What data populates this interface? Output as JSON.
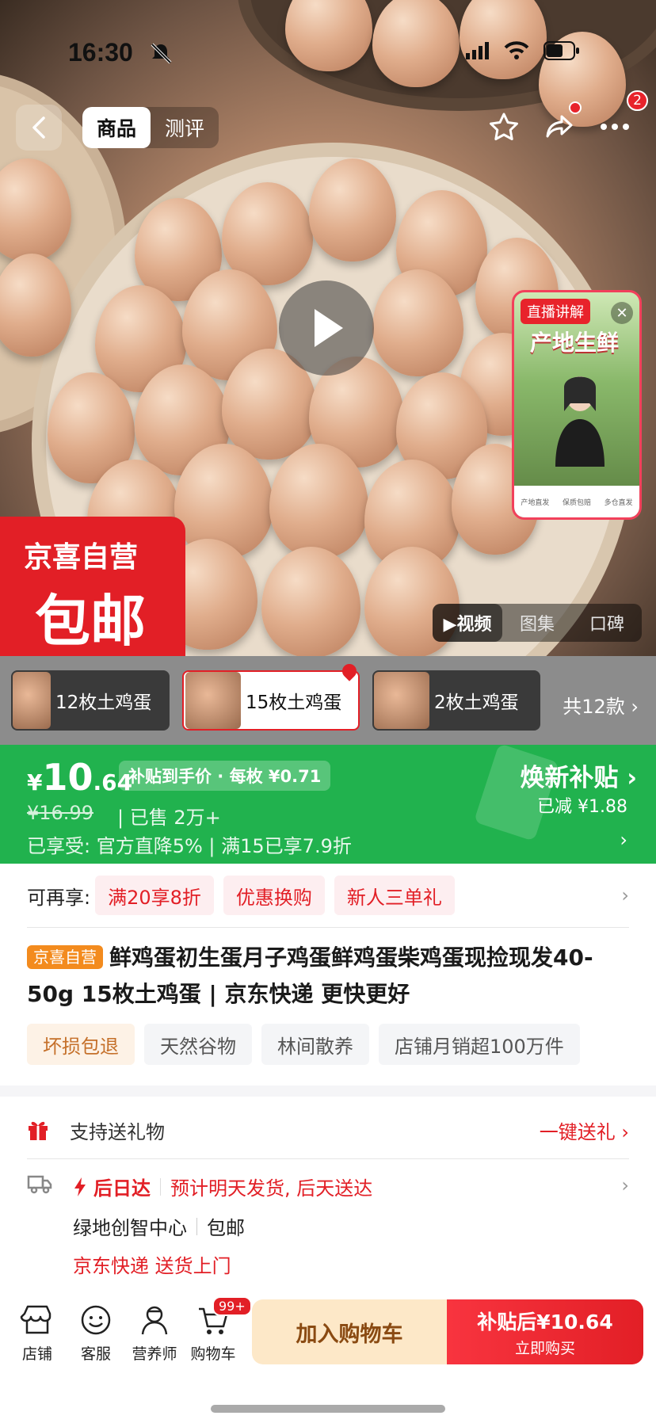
{
  "status_bar": {
    "time": "16:30"
  },
  "nav": {
    "tabs": [
      {
        "label": "商品",
        "active": true
      },
      {
        "label": "测评",
        "active": false
      }
    ],
    "more_badge": "2"
  },
  "hero": {
    "live": {
      "tag": "直播讲解",
      "title": "产地生鲜",
      "bottom_items": [
        "产地直发",
        "保质包赔",
        "多仓直发"
      ]
    },
    "badge": {
      "line1": "京喜自营",
      "line2": "包邮"
    },
    "media_tabs": [
      {
        "label": "▶视频",
        "active": true
      },
      {
        "label": "图集",
        "active": false
      },
      {
        "label": "口碑",
        "active": false
      }
    ]
  },
  "variants": {
    "items": [
      {
        "label": "12枚土鸡蛋",
        "selected": false
      },
      {
        "label": "15枚土鸡蛋",
        "selected": true
      },
      {
        "label": "2枚土鸡蛋",
        "selected": false
      }
    ],
    "total": "共12款 ›"
  },
  "price": {
    "currency": "¥",
    "integer": "10",
    "decimal": ".64",
    "tag": "补贴到手价 · 每枚 ¥0.71",
    "original": "¥16.99",
    "sold": "| 已售 2万+",
    "line3": "已享受: 官方直降5% | 满15已享7.9折",
    "right_title": "焕新补贴",
    "right_sub": "已减 ¥1.88",
    "accent": "#21b24e"
  },
  "promo": {
    "label": "可再享:",
    "chips": [
      "满20享8折",
      "优惠换购",
      "新人三单礼"
    ]
  },
  "product": {
    "self_tag": "京喜自营",
    "title": "鲜鸡蛋初生蛋月子鸡蛋鲜鸡蛋柴鸡蛋现捡现发40-50g 15枚土鸡蛋 | 京东快递 更快更好",
    "tags": [
      "坏损包退",
      "天然谷物",
      "林间散养",
      "店铺月销超100万件"
    ]
  },
  "gift": {
    "label": "支持送礼物",
    "link": "一键送礼 ›"
  },
  "shipping": {
    "speed": "后日达",
    "estimate": "预计明天发货, 后天送达",
    "address": "绿地创智中心",
    "fee": "包邮",
    "carrier": "京东快递   送货上门"
  },
  "bottom_bar": {
    "items": [
      "店铺",
      "客服",
      "营养师",
      "购物车"
    ],
    "cart_badge": "99+",
    "add_cart": "加入购物车",
    "buy_line1": "补贴后¥10.64",
    "buy_line2": "立即购买"
  },
  "colors": {
    "brand_red": "#e21f26",
    "price_green": "#21b24e"
  }
}
